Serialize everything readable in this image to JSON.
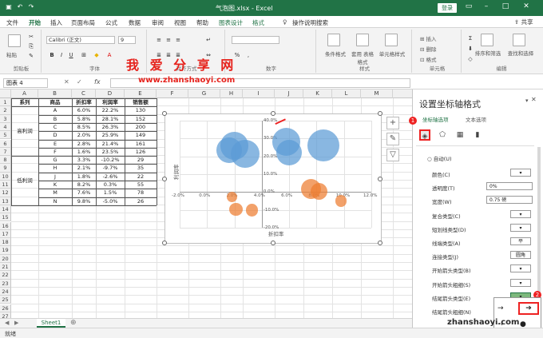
{
  "window": {
    "title": "气泡图.xlsx  -  Excel",
    "login": "登录"
  },
  "tabs": [
    "文件",
    "开始",
    "插入",
    "页面布局",
    "公式",
    "数据",
    "审阅",
    "视图",
    "帮助",
    "图表设计",
    "格式"
  ],
  "tell_me": "操作说明搜索",
  "share": "共享",
  "ribbon": {
    "paste": "粘贴",
    "font_name": "Calibri (正文)",
    "font_size": "9",
    "groups": [
      "剪贴板",
      "字体",
      "对齐方式",
      "数字",
      "样式",
      "单元格",
      "编辑"
    ],
    "cond_format": "条件格式",
    "table_format": "套用\n表格格式",
    "cell_style": "单元格样式",
    "insert": "插入",
    "delete": "删除",
    "format": "格式",
    "sort": "排序和筛选",
    "find": "查找和选择"
  },
  "formula_bar": {
    "name_box": "图表 4",
    "fx": "fx",
    "value": ""
  },
  "columns": [
    "A",
    "B",
    "C",
    "D",
    "E",
    "F",
    "G",
    "H",
    "I",
    "J",
    "K",
    "L",
    "M"
  ],
  "rows": [
    "1",
    "2",
    "3",
    "4",
    "5",
    "6",
    "7",
    "8",
    "9",
    "10",
    "11",
    "12",
    "13",
    "14",
    "15",
    "16",
    "17",
    "18",
    "19",
    "20",
    "21",
    "22",
    "23",
    "24",
    "25",
    "26",
    "27"
  ],
  "table": {
    "headers": [
      "系列",
      "商品",
      "折扣率",
      "利润率",
      "销售额"
    ],
    "groups": [
      "高利润",
      "低利润"
    ],
    "rows": [
      [
        "A",
        "6.0%",
        "22.2%",
        "130"
      ],
      [
        "B",
        "5.8%",
        "28.1%",
        "152"
      ],
      [
        "C",
        "8.5%",
        "26.3%",
        "200"
      ],
      [
        "D",
        "2.0%",
        "25.9%",
        "149"
      ],
      [
        "E",
        "2.8%",
        "21.4%",
        "161"
      ],
      [
        "F",
        "1.6%",
        "23.5%",
        "126"
      ],
      [
        "G",
        "3.3%",
        "-10.2%",
        "29"
      ],
      [
        "H",
        "2.1%",
        "-9.7%",
        "35"
      ],
      [
        "J",
        "1.8%",
        "-2.6%",
        "22"
      ],
      [
        "K",
        "8.2%",
        "0.3%",
        "55"
      ],
      [
        "M",
        "7.6%",
        "1.5%",
        "78"
      ],
      [
        "N",
        "9.8%",
        "-5.0%",
        "26"
      ]
    ]
  },
  "chart_data": {
    "type": "scatter",
    "title": "",
    "xlabel": "折扣率",
    "ylabel": "利润率",
    "xlim": [
      -0.02,
      0.12
    ],
    "ylim": [
      -0.2,
      0.4
    ],
    "x_ticks": [
      "-2.0%",
      "0.0%",
      "2.0%",
      "4.0%",
      "6.0%",
      "8.0%",
      "10.0%",
      "12.0%"
    ],
    "y_ticks": [
      "40.0%",
      "30.0%",
      "20.0%",
      "10.0%",
      "0.0%",
      "-10.0%",
      "-20.0%"
    ],
    "series": [
      {
        "x": [
          0.06,
          0.058,
          0.085,
          0.02,
          0.028,
          0.016
        ],
        "y": [
          0.222,
          0.281,
          0.263,
          0.259,
          0.214,
          0.235
        ],
        "size": [
          130,
          152,
          200,
          149,
          161,
          126
        ],
        "color": "#5b9bd5"
      },
      {
        "x": [
          0.033,
          0.021,
          0.018,
          0.082,
          0.076,
          0.098
        ],
        "y": [
          -0.102,
          -0.097,
          -0.026,
          0.003,
          0.015,
          -0.05
        ],
        "size": [
          29,
          35,
          22,
          55,
          78,
          26
        ],
        "color": "#ed7d31"
      }
    ]
  },
  "watermark": {
    "line1": "我 爱 分 享 网",
    "line2": "www.zhanshaoyi.com",
    "line3": "zhanshaoyi.com"
  },
  "pane": {
    "title": "设置坐标轴格式",
    "tab_axis": "坐标轴选项",
    "tab_text": "文本选项",
    "auto": "自动(U)",
    "rows": [
      {
        "label": "颜色(C)",
        "value": ""
      },
      {
        "label": "透明度(T)",
        "value": "0%"
      },
      {
        "label": "宽度(W)",
        "value": "0.75 磅"
      },
      {
        "label": "复合类型(C)",
        "value": ""
      },
      {
        "label": "短划线类型(D)",
        "value": ""
      },
      {
        "label": "线端类型(A)",
        "value": "平"
      },
      {
        "label": "连接类型(J)",
        "value": "圆角"
      },
      {
        "label": "开始箭头类型(B)",
        "value": ""
      },
      {
        "label": "开始箭头粗细(S)",
        "value": ""
      },
      {
        "label": "结尾箭头类型(E)",
        "value": ""
      },
      {
        "label": "结尾箭头粗细(N)",
        "value": ""
      }
    ]
  },
  "callouts": [
    "1",
    "2",
    "3"
  ],
  "sheet_tab": "Sheet1",
  "status": {
    "ready": "就绪",
    "zoom": "100%"
  },
  "colors": {
    "excel_green": "#217346",
    "accent_red": "#e22222"
  }
}
